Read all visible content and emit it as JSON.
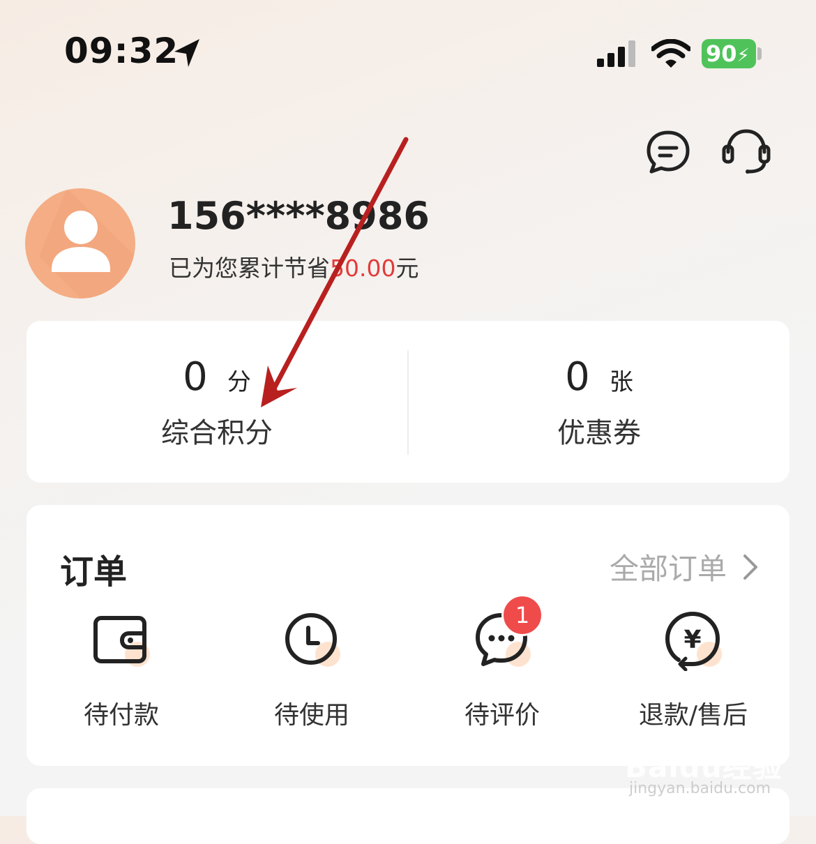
{
  "status_bar": {
    "time": "09:32",
    "battery": "90"
  },
  "profile": {
    "phone": "156****8986",
    "saving_prefix": "已为您累计节省",
    "saving_amount": "50.00",
    "saving_suffix": "元"
  },
  "stats": [
    {
      "value": "0",
      "unit": "分",
      "label": "综合积分"
    },
    {
      "value": "0",
      "unit": "张",
      "label": "优惠券"
    }
  ],
  "orders": {
    "title": "订单",
    "all_label": "全部订单",
    "items": [
      {
        "label": "待付款",
        "icon": "wallet-icon"
      },
      {
        "label": "待使用",
        "icon": "clock-icon"
      },
      {
        "label": "待评价",
        "icon": "comment-icon",
        "badge": "1"
      },
      {
        "label": "退款/售后",
        "icon": "refund-icon"
      }
    ]
  },
  "watermark": {
    "brand": "Baidu经验",
    "url": "jingyan.baidu.com"
  },
  "colors": {
    "accent_red": "#e23b3b",
    "badge_red": "#ef4b4b",
    "avatar_orange": "#f4ad84",
    "battery_green": "#4fc35a",
    "annotation_arrow": "#b8201f"
  }
}
